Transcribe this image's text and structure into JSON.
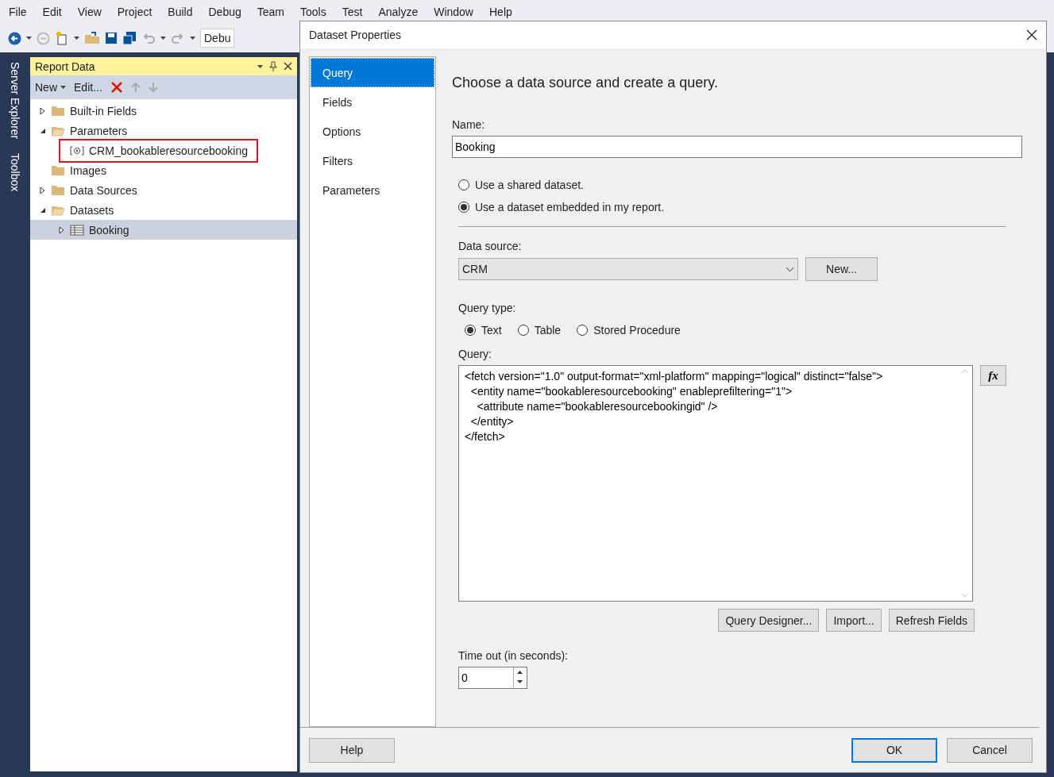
{
  "menu": [
    "File",
    "Edit",
    "View",
    "Project",
    "Build",
    "Debug",
    "Team",
    "Tools",
    "Test",
    "Analyze",
    "Window",
    "Help"
  ],
  "toolbar": {
    "configuration": "Debu"
  },
  "side_tabs": [
    "Server Explorer",
    "Toolbox"
  ],
  "report_data": {
    "title": "Report Data",
    "actions": [
      "New",
      "Edit..."
    ],
    "tree": [
      {
        "label": "Built-in Fields",
        "kind": "folder",
        "expandable": true,
        "expanded": false,
        "selected": false,
        "annotated": false
      },
      {
        "label": "Parameters",
        "kind": "folder",
        "expandable": true,
        "expanded": true,
        "selected": false,
        "annotated": false,
        "children": [
          {
            "label": "CRM_bookableresourcebooking",
            "kind": "parameter",
            "expandable": false,
            "selected": false,
            "annotated": true
          }
        ]
      },
      {
        "label": "Images",
        "kind": "folder",
        "expandable": false,
        "expanded": false,
        "selected": false,
        "annotated": false
      },
      {
        "label": "Data Sources",
        "kind": "folder",
        "expandable": true,
        "expanded": false,
        "selected": false,
        "annotated": false
      },
      {
        "label": "Datasets",
        "kind": "folder",
        "expandable": true,
        "expanded": true,
        "selected": false,
        "annotated": false,
        "children": [
          {
            "label": "Booking",
            "kind": "dataset",
            "expandable": true,
            "expanded": false,
            "selected": true,
            "annotated": false
          }
        ]
      }
    ]
  },
  "dialog": {
    "title": "Dataset Properties",
    "nav": [
      {
        "label": "Query",
        "selected": true
      },
      {
        "label": "Fields",
        "selected": false
      },
      {
        "label": "Options",
        "selected": false
      },
      {
        "label": "Filters",
        "selected": false
      },
      {
        "label": "Parameters",
        "selected": false
      }
    ],
    "heading": "Choose a data source and create a query.",
    "name_label": "Name:",
    "name": "Booking",
    "dataset_options": [
      {
        "label": "Use a shared dataset.",
        "selected": false
      },
      {
        "label": "Use a dataset embedded in my report.",
        "selected": true
      }
    ],
    "data_source_label": "Data source:",
    "data_source": "CRM",
    "new_button": "New...",
    "query_type_label": "Query type:",
    "query_types": [
      {
        "label": "Text",
        "selected": true
      },
      {
        "label": "Table",
        "selected": false
      },
      {
        "label": "Stored Procedure",
        "selected": false
      }
    ],
    "query_label": "Query:",
    "query_lines": [
      "<fetch version=\"1.0\" output-format=\"xml-platform\" mapping=\"logical\" distinct=\"false\">",
      "  <entity name=\"bookableresourcebooking\" enableprefiltering=\"1\">",
      "    <attribute name=\"bookableresourcebookingid\" />",
      "  </entity>",
      "</fetch>"
    ],
    "expression_button": "fx",
    "query_buttons": [
      "Query Designer...",
      "Import...",
      "Refresh Fields"
    ],
    "timeout_label": "Time out (in seconds):",
    "timeout": "0",
    "footer": [
      {
        "label": "Help",
        "kind": "help"
      },
      {
        "label": "OK",
        "kind": "default"
      },
      {
        "label": "Cancel",
        "kind": "normal"
      }
    ]
  }
}
